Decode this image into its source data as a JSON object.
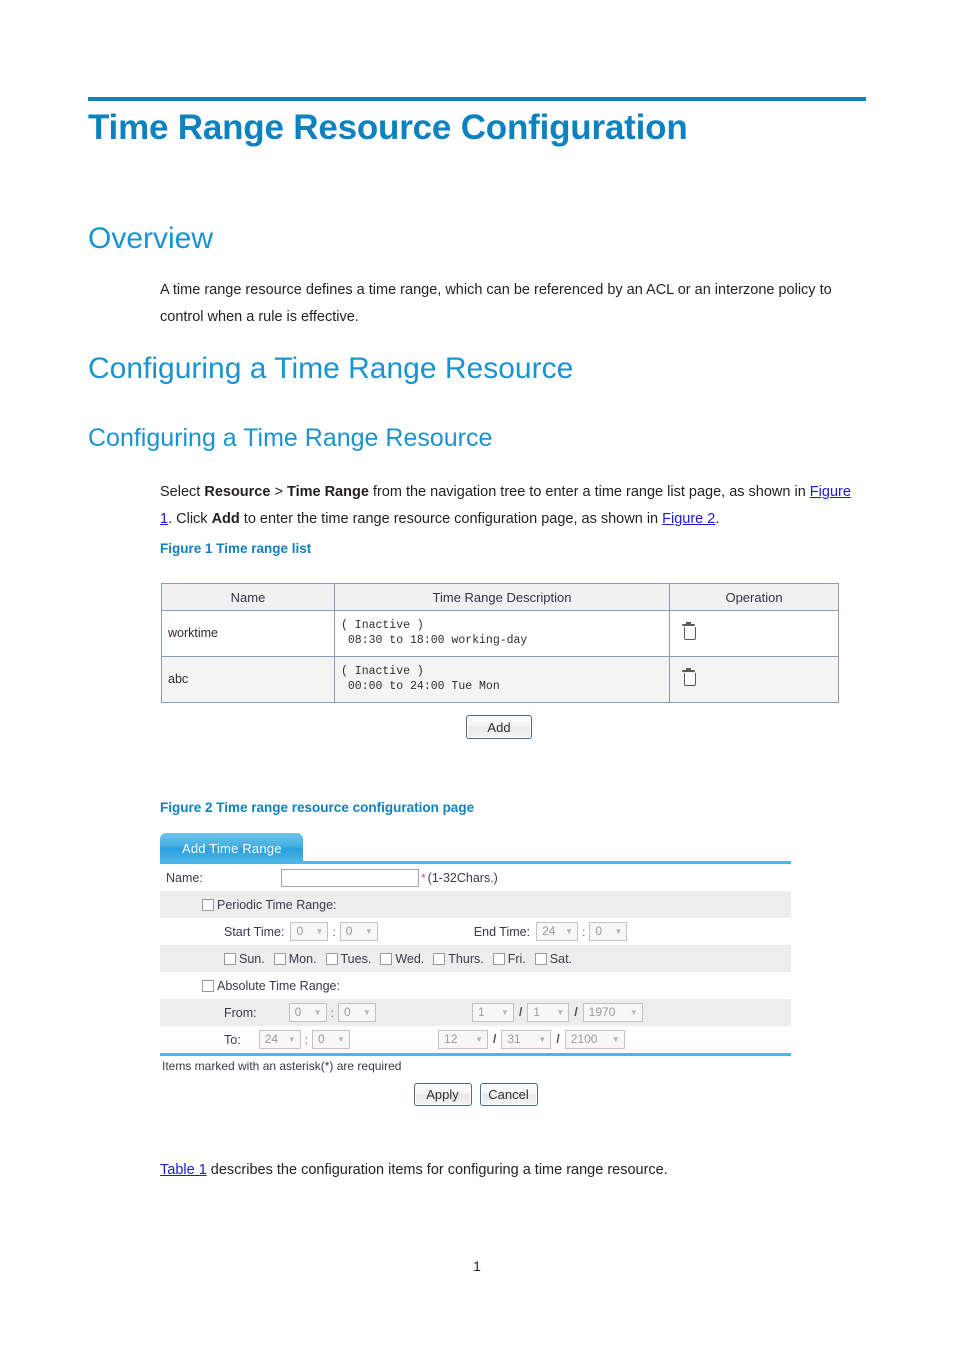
{
  "document": {
    "title": "Time Range Resource Configuration",
    "page_number": "1"
  },
  "sections": {
    "overview": {
      "heading": "Overview",
      "paragraph_1": "A time range resource defines a time range, which can be referenced by an ACL or an interzone policy ",
      "paragraph_2": "to control when a rule is effective."
    },
    "configuring": {
      "heading": "Configuring a Time Range Resource",
      "subheading": "Configuring a Time Range Resource",
      "select_text_1": "Select ",
      "select_bold_1": "Resource",
      "select_text_2": " > ",
      "select_bold_2": "Time Range",
      "select_text_3": " from the navigation tree to enter a time range list page, as shown in ",
      "select_link_1": "Figure 1",
      "select_text_4": ". Click ",
      "select_bold_3": "Add",
      "select_text_5": " to enter the time range resource configuration page, as shown in ",
      "select_link_2": "Figure 2",
      "select_text_6": "."
    },
    "closing": {
      "link": "Table 1",
      "text": " describes the configuration items for configuring a time range resource."
    }
  },
  "figure1": {
    "caption": "Figure 1 Time range list",
    "columns": [
      "Name",
      "Time Range Description",
      "Operation"
    ],
    "rows": [
      {
        "name": "worktime",
        "description_line1": "( Inactive )",
        "description_line2": " 08:30 to 18:00 working-day",
        "operation_icon": "delete-icon"
      },
      {
        "name": "abc",
        "description_line1": "( Inactive )",
        "description_line2": " 00:00 to 24:00 Tue Mon",
        "operation_icon": "delete-icon"
      }
    ],
    "add_button": "Add"
  },
  "figure2": {
    "caption": "Figure 2 Time range resource configuration page",
    "tab_label": "Add Time Range",
    "name_label": "Name:",
    "name_value": "",
    "name_placeholder": "",
    "name_required_marker": "*",
    "name_hint": "(1-32Chars.)",
    "periodic": {
      "label": "Periodic Time Range:",
      "checked": false,
      "start_time_label": "Start Time:",
      "start_hour": "0",
      "start_minute": "0",
      "end_time_label": "End Time:",
      "end_hour": "24",
      "end_minute": "0",
      "weekdays": [
        {
          "label": "Sun.",
          "checked": false
        },
        {
          "label": "Mon.",
          "checked": false
        },
        {
          "label": "Tues.",
          "checked": false
        },
        {
          "label": "Wed.",
          "checked": false
        },
        {
          "label": "Thurs.",
          "checked": false
        },
        {
          "label": "Fri.",
          "checked": false
        },
        {
          "label": "Sat.",
          "checked": false
        }
      ]
    },
    "absolute": {
      "label": "Absolute Time Range:",
      "checked": false,
      "from_label": "From:",
      "from_hour": "0",
      "from_minute": "0",
      "from_month": "1",
      "from_day": "1",
      "from_year": "1970",
      "to_label": "To:",
      "to_hour": "24",
      "to_minute": "0",
      "to_month": "12",
      "to_day": "31",
      "to_year": "2100"
    },
    "required_note": "Items marked with an asterisk(*) are required",
    "apply_button": "Apply",
    "cancel_button": "Cancel"
  },
  "colors": {
    "accent_blue": "#0e81bf",
    "heading_blue": "#1b93d1",
    "link_blue": "#1a1ad6",
    "tab_blue": "#45afe2",
    "required_pink": "#e8467c"
  }
}
